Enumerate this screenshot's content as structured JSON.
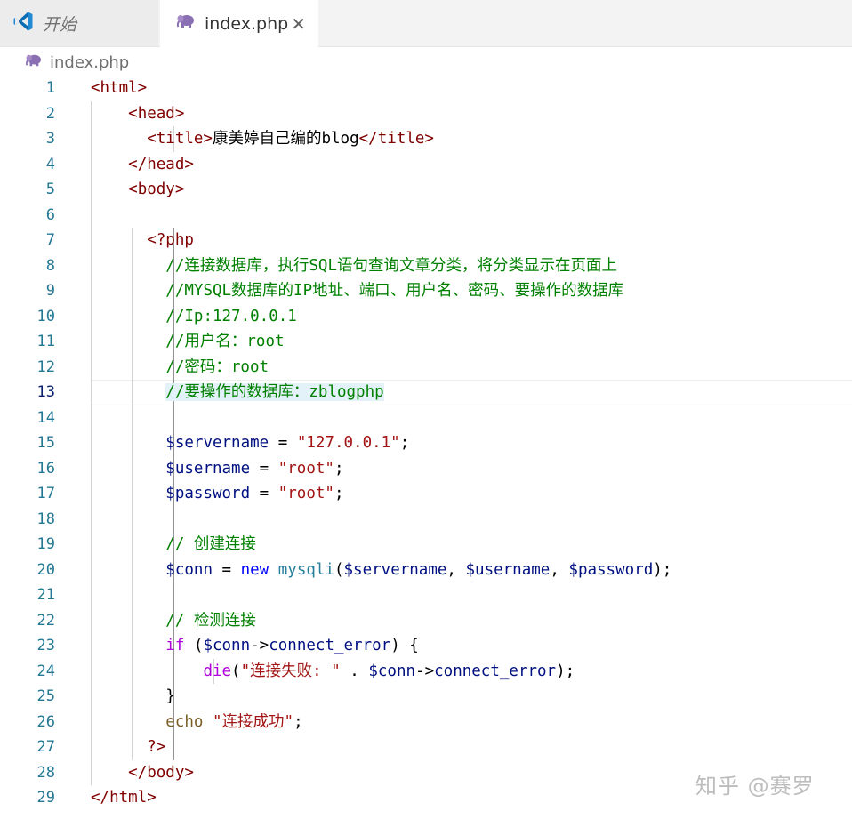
{
  "tabs": [
    {
      "label": "开始",
      "icon": "vscode-logo-icon"
    },
    {
      "label": "index.php",
      "icon": "php-elephant-icon",
      "close": "✕"
    }
  ],
  "breadcrumb": {
    "label": "index.php",
    "icon": "php-elephant-icon"
  },
  "editor": {
    "current_line": 13,
    "line_numbers": [
      "1",
      "2",
      "3",
      "4",
      "5",
      "6",
      "7",
      "8",
      "9",
      "10",
      "11",
      "12",
      "13",
      "14",
      "15",
      "16",
      "17",
      "18",
      "19",
      "20",
      "21",
      "22",
      "23",
      "24",
      "25",
      "26",
      "27",
      "28",
      "29"
    ],
    "lines": [
      [
        [
          "t-tag",
          "<html>"
        ]
      ],
      [
        [
          "t-plain",
          "    "
        ],
        [
          "t-tag",
          "<head>"
        ]
      ],
      [
        [
          "t-plain",
          "      "
        ],
        [
          "t-tag",
          "<title>"
        ],
        [
          "t-plain",
          "康美婷自己编的blog"
        ],
        [
          "t-tag",
          "</title>"
        ]
      ],
      [
        [
          "t-plain",
          "    "
        ],
        [
          "t-tag",
          "</head>"
        ]
      ],
      [
        [
          "t-plain",
          "    "
        ],
        [
          "t-tag",
          "<body>"
        ]
      ],
      [],
      [
        [
          "t-plain",
          "      "
        ],
        [
          "t-php",
          "<?php"
        ]
      ],
      [
        [
          "t-plain",
          "        "
        ],
        [
          "t-cmt",
          "//连接数据库，执行SQL语句查询文章分类，将分类显示在页面上"
        ]
      ],
      [
        [
          "t-plain",
          "        "
        ],
        [
          "t-cmt",
          "//MYSQL数据库的IP地址、端口、用户名、密码、要操作的数据库"
        ]
      ],
      [
        [
          "t-plain",
          "        "
        ],
        [
          "t-cmt",
          "//Ip:127.0.0.1"
        ]
      ],
      [
        [
          "t-plain",
          "        "
        ],
        [
          "t-cmt",
          "//用户名：root"
        ]
      ],
      [
        [
          "t-plain",
          "        "
        ],
        [
          "t-cmt",
          "//密码：root"
        ]
      ],
      [
        [
          "t-plain",
          "        "
        ],
        [
          "t-cmt t-hl",
          "//要操作的数据库：zblogphp"
        ]
      ],
      [],
      [
        [
          "t-plain",
          "        "
        ],
        [
          "t-var",
          "$servername"
        ],
        [
          "t-plain",
          " = "
        ],
        [
          "t-str",
          "\"127.0.0.1\""
        ],
        [
          "t-plain",
          ";"
        ]
      ],
      [
        [
          "t-plain",
          "        "
        ],
        [
          "t-var",
          "$username"
        ],
        [
          "t-plain",
          " = "
        ],
        [
          "t-str",
          "\"root\""
        ],
        [
          "t-plain",
          ";"
        ]
      ],
      [
        [
          "t-plain",
          "        "
        ],
        [
          "t-var",
          "$password"
        ],
        [
          "t-plain",
          " = "
        ],
        [
          "t-str",
          "\"root\""
        ],
        [
          "t-plain",
          ";"
        ]
      ],
      [],
      [
        [
          "t-plain",
          "        "
        ],
        [
          "t-cmt",
          "// 创建连接"
        ]
      ],
      [
        [
          "t-plain",
          "        "
        ],
        [
          "t-var",
          "$conn"
        ],
        [
          "t-plain",
          " = "
        ],
        [
          "t-kw",
          "new"
        ],
        [
          "t-plain",
          " "
        ],
        [
          "t-cls",
          "mysqli"
        ],
        [
          "t-plain",
          "("
        ],
        [
          "t-var",
          "$servername"
        ],
        [
          "t-plain",
          ", "
        ],
        [
          "t-var",
          "$username"
        ],
        [
          "t-plain",
          ", "
        ],
        [
          "t-var",
          "$password"
        ],
        [
          "t-plain",
          ");"
        ]
      ],
      [],
      [
        [
          "t-plain",
          "        "
        ],
        [
          "t-cmt",
          "// 检测连接"
        ]
      ],
      [
        [
          "t-plain",
          "        "
        ],
        [
          "t-ctrl",
          "if"
        ],
        [
          "t-plain",
          " ("
        ],
        [
          "t-var",
          "$conn"
        ],
        [
          "t-plain",
          "->"
        ],
        [
          "t-var",
          "connect_error"
        ],
        [
          "t-plain",
          ") {"
        ]
      ],
      [
        [
          "t-plain",
          "            "
        ],
        [
          "t-ctrl",
          "die"
        ],
        [
          "t-plain",
          "("
        ],
        [
          "t-str",
          "\"连接失败: \""
        ],
        [
          "t-plain",
          " . "
        ],
        [
          "t-var",
          "$conn"
        ],
        [
          "t-plain",
          "->"
        ],
        [
          "t-var",
          "connect_error"
        ],
        [
          "t-plain",
          ");"
        ]
      ],
      [
        [
          "t-plain",
          "        "
        ],
        [
          "t-plain",
          "}"
        ]
      ],
      [
        [
          "t-plain",
          "        "
        ],
        [
          "t-fn",
          "echo"
        ],
        [
          "t-plain",
          " "
        ],
        [
          "t-str",
          "\"连接成功\""
        ],
        [
          "t-plain",
          ";"
        ]
      ],
      [
        [
          "t-plain",
          "      "
        ],
        [
          "t-php",
          "?>"
        ]
      ],
      [
        [
          "t-plain",
          "    "
        ],
        [
          "t-tag",
          "</body>"
        ]
      ],
      [
        [
          "t-tag",
          "</html>"
        ]
      ]
    ]
  },
  "watermark": "知乎 @赛罗"
}
